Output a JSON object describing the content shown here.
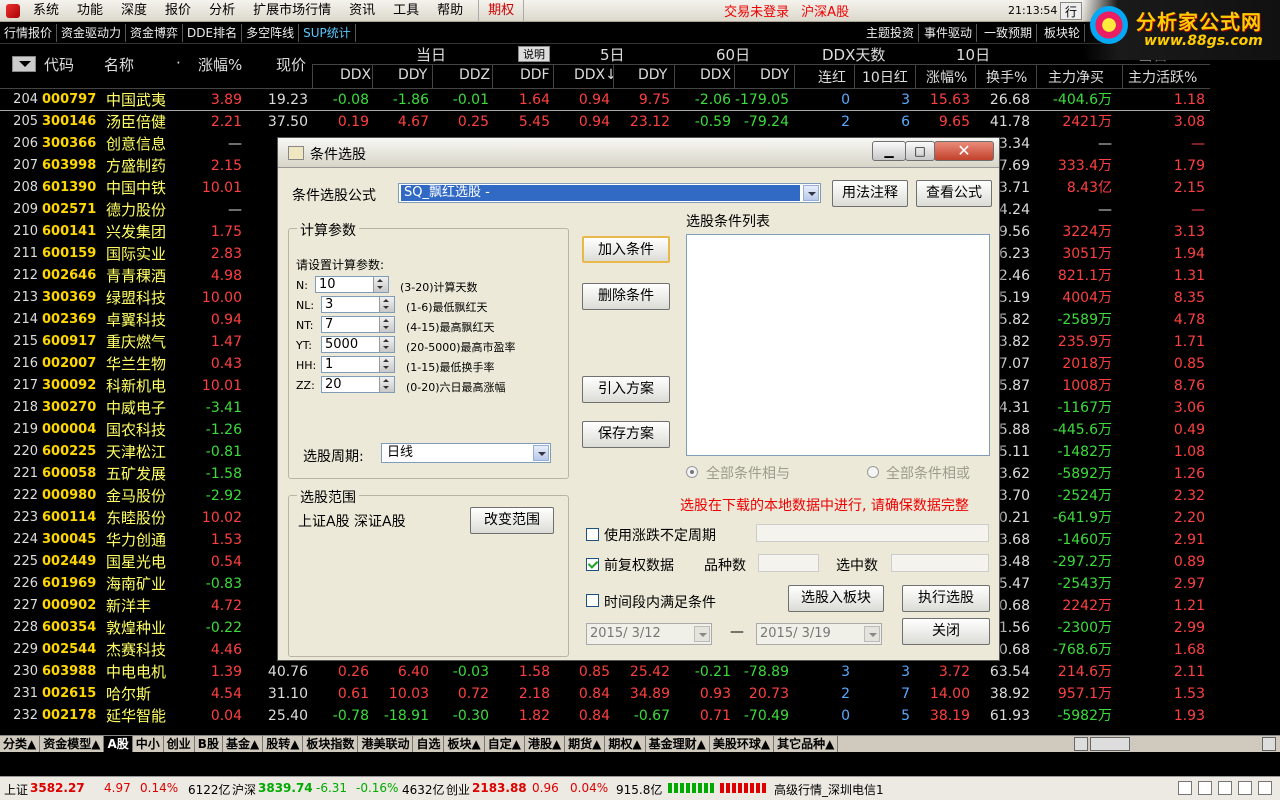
{
  "menu": {
    "items": [
      "系统",
      "功能",
      "深度",
      "报价",
      "分析",
      "扩展市场行情",
      "资讯",
      "工具",
      "帮助"
    ],
    "qiquan": "期权",
    "login": "交易未登录",
    "market": "沪深A股",
    "clock": "21:13:54 周四",
    "trade": "行"
  },
  "brand": {
    "name": "分析家公式网",
    "url": "www.88gs.com"
  },
  "toolbar": {
    "items": [
      "行情报价",
      "资金驱动力",
      "资金博弈",
      "DDE排名",
      "多空阵线",
      "SUP统计"
    ],
    "right_items": [
      "主题投资",
      "事件驱动",
      "一致预期",
      "板块轮"
    ]
  },
  "header": {
    "code": "代码",
    "name": "名称",
    "change": "涨幅%",
    "price": "现价",
    "group_today": "当日",
    "explain": "说明",
    "group_5": "5日",
    "group_60": "60日",
    "group_ddx_days": "DDX天数",
    "group_10": "10日",
    "group_today2": "当日",
    "sub": [
      "DDX",
      "DDY",
      "DDZ",
      "DDF",
      "DDX↓",
      "DDY",
      "DDX",
      "DDY",
      "连红",
      "10日红",
      "涨幅%",
      "换手%",
      "主力净买",
      "主力活跃%"
    ]
  },
  "rows": [
    {
      "i": "204",
      "code": "000797",
      "name": "中国武夷",
      "chg": "3.89",
      "price": "19.23",
      "ddx": "-0.08",
      "ddy": "-1.86",
      "ddz": "-0.01",
      "ddf": "1.64",
      "ddx5": "0.94",
      "ddy5": "9.75",
      "ddx60": "-2.06",
      "ddy60": "-179.05",
      "lh": "0",
      "h10": "3",
      "zf10": "15.63",
      "hs": "26.68",
      "net": "-404.6万",
      "act": "1.18"
    },
    {
      "i": "205",
      "code": "300146",
      "name": "汤臣倍健",
      "chg": "2.21",
      "price": "37.50",
      "ddx": "0.19",
      "ddy": "4.67",
      "ddz": "0.25",
      "ddf": "5.45",
      "ddx5": "0.94",
      "ddy5": "23.12",
      "ddx60": "-0.59",
      "ddy60": "-79.24",
      "lh": "2",
      "h10": "6",
      "zf10": "9.65",
      "hs": "41.78",
      "net": "2421万",
      "act": "3.08"
    },
    {
      "i": "206",
      "code": "300366",
      "name": "创意信息",
      "chg": "—",
      "price": "",
      "ddx": "",
      "ddy": "",
      "ddz": "",
      "ddf": "",
      "ddx5": "",
      "ddy5": "",
      "ddx60": "",
      "ddy60": "",
      "lh": "",
      "h10": "",
      "zf10": "",
      "hs": "3.34",
      "net": "—",
      "act": "—"
    },
    {
      "i": "207",
      "code": "603998",
      "name": "方盛制药",
      "chg": "2.15",
      "price": "",
      "ddx": "",
      "ddy": "",
      "ddz": "",
      "ddf": "",
      "ddx5": "",
      "ddy5": "",
      "ddx60": "",
      "ddy60": "",
      "lh": "",
      "h10": "",
      "zf10": "",
      "hs": "7.69",
      "net": "333.4万",
      "act": "1.79"
    },
    {
      "i": "208",
      "code": "601390",
      "name": "中国中铁",
      "chg": "10.01",
      "price": "",
      "ddx": "",
      "ddy": "",
      "ddz": "",
      "ddf": "",
      "ddx5": "",
      "ddy5": "",
      "ddx60": "",
      "ddy60": "",
      "lh": "",
      "h10": "",
      "zf10": "",
      "hs": "3.71",
      "net": "8.43亿",
      "act": "2.15"
    },
    {
      "i": "209",
      "code": "002571",
      "name": "德力股份",
      "chg": "—",
      "price": "",
      "ddx": "",
      "ddy": "",
      "ddz": "",
      "ddf": "",
      "ddx5": "",
      "ddy5": "",
      "ddx60": "",
      "ddy60": "",
      "lh": "",
      "h10": "",
      "zf10": "",
      "hs": "4.24",
      "net": "—",
      "act": "—"
    },
    {
      "i": "210",
      "code": "600141",
      "name": "兴发集团",
      "chg": "1.75",
      "price": "",
      "ddx": "",
      "ddy": "",
      "ddz": "",
      "ddf": "",
      "ddx5": "",
      "ddy5": "",
      "ddx60": "",
      "ddy60": "",
      "lh": "",
      "h10": "",
      "zf10": "",
      "hs": "9.56",
      "net": "3224万",
      "act": "3.13"
    },
    {
      "i": "211",
      "code": "600159",
      "name": "国际实业",
      "chg": "2.83",
      "price": "",
      "ddx": "",
      "ddy": "",
      "ddz": "",
      "ddf": "",
      "ddx5": "",
      "ddy5": "",
      "ddx60": "",
      "ddy60": "",
      "lh": "",
      "h10": "",
      "zf10": "",
      "hs": "6.23",
      "net": "3051万",
      "act": "1.94"
    },
    {
      "i": "212",
      "code": "002646",
      "name": "青青稞酒",
      "chg": "4.98",
      "price": "",
      "ddx": "",
      "ddy": "",
      "ddz": "",
      "ddf": "",
      "ddx5": "",
      "ddy5": "",
      "ddx60": "",
      "ddy60": "",
      "lh": "",
      "h10": "",
      "zf10": "",
      "hs": "2.46",
      "net": "821.1万",
      "act": "1.31"
    },
    {
      "i": "213",
      "code": "300369",
      "name": "绿盟科技",
      "chg": "10.00",
      "price": "",
      "ddx": "",
      "ddy": "",
      "ddz": "",
      "ddf": "",
      "ddx5": "",
      "ddy5": "",
      "ddx60": "",
      "ddy60": "",
      "lh": "",
      "h10": "",
      "zf10": "",
      "hs": "5.19",
      "net": "4004万",
      "act": "8.35"
    },
    {
      "i": "214",
      "code": "002369",
      "name": "卓翼科技",
      "chg": "0.94",
      "price": "",
      "ddx": "",
      "ddy": "",
      "ddz": "",
      "ddf": "",
      "ddx5": "",
      "ddy5": "",
      "ddx60": "",
      "ddy60": "",
      "lh": "",
      "h10": "",
      "zf10": "",
      "hs": "5.82",
      "net": "-2589万",
      "act": "4.78"
    },
    {
      "i": "215",
      "code": "600917",
      "name": "重庆燃气",
      "chg": "1.47",
      "price": "",
      "ddx": "",
      "ddy": "",
      "ddz": "",
      "ddf": "",
      "ddx5": "",
      "ddy5": "",
      "ddx60": "",
      "ddy60": "",
      "lh": "",
      "h10": "",
      "zf10": "",
      "hs": "3.82",
      "net": "235.9万",
      "act": "1.71"
    },
    {
      "i": "216",
      "code": "002007",
      "name": "华兰生物",
      "chg": "0.43",
      "price": "",
      "ddx": "",
      "ddy": "",
      "ddz": "",
      "ddf": "",
      "ddx5": "",
      "ddy5": "",
      "ddx60": "",
      "ddy60": "",
      "lh": "",
      "h10": "",
      "zf10": "",
      "hs": "7.07",
      "net": "2018万",
      "act": "0.85"
    },
    {
      "i": "217",
      "code": "300092",
      "name": "科新机电",
      "chg": "10.01",
      "price": "",
      "ddx": "",
      "ddy": "",
      "ddz": "",
      "ddf": "",
      "ddx5": "",
      "ddy5": "",
      "ddx60": "",
      "ddy60": "",
      "lh": "",
      "h10": "",
      "zf10": "",
      "hs": "5.87",
      "net": "1008万",
      "act": "8.76"
    },
    {
      "i": "218",
      "code": "300270",
      "name": "中威电子",
      "chg": "-3.41",
      "price": "",
      "ddx": "",
      "ddy": "",
      "ddz": "",
      "ddf": "",
      "ddx5": "",
      "ddy5": "",
      "ddx60": "",
      "ddy60": "",
      "lh": "",
      "h10": "",
      "zf10": "",
      "hs": "4.31",
      "net": "-1167万",
      "act": "3.06"
    },
    {
      "i": "219",
      "code": "000004",
      "name": "国农科技",
      "chg": "-1.26",
      "price": "",
      "ddx": "",
      "ddy": "",
      "ddz": "",
      "ddf": "",
      "ddx5": "",
      "ddy5": "",
      "ddx60": "",
      "ddy60": "",
      "lh": "",
      "h10": "",
      "zf10": "",
      "hs": "5.88",
      "net": "-445.6万",
      "act": "0.49"
    },
    {
      "i": "220",
      "code": "600225",
      "name": "天津松江",
      "chg": "-0.81",
      "price": "",
      "ddx": "",
      "ddy": "",
      "ddz": "",
      "ddf": "",
      "ddx5": "",
      "ddy5": "",
      "ddx60": "",
      "ddy60": "",
      "lh": "",
      "h10": "",
      "zf10": "",
      "hs": "5.11",
      "net": "-1482万",
      "act": "1.08"
    },
    {
      "i": "221",
      "code": "600058",
      "name": "五矿发展",
      "chg": "-1.58",
      "price": "",
      "ddx": "",
      "ddy": "",
      "ddz": "",
      "ddf": "",
      "ddx5": "",
      "ddy5": "",
      "ddx60": "",
      "ddy60": "",
      "lh": "",
      "h10": "",
      "zf10": "",
      "hs": "3.62",
      "net": "-5892万",
      "act": "1.26"
    },
    {
      "i": "222",
      "code": "000980",
      "name": "金马股份",
      "chg": "-2.92",
      "price": "",
      "ddx": "",
      "ddy": "",
      "ddz": "",
      "ddf": "",
      "ddx5": "",
      "ddy5": "",
      "ddx60": "",
      "ddy60": "",
      "lh": "",
      "h10": "",
      "zf10": "",
      "hs": "3.70",
      "net": "-2524万",
      "act": "2.32"
    },
    {
      "i": "223",
      "code": "600114",
      "name": "东睦股份",
      "chg": "10.02",
      "price": "",
      "ddx": "",
      "ddy": "",
      "ddz": "",
      "ddf": "",
      "ddx5": "",
      "ddy5": "",
      "ddx60": "",
      "ddy60": "",
      "lh": "",
      "h10": "",
      "zf10": "",
      "hs": "0.21",
      "net": "-641.9万",
      "act": "2.20"
    },
    {
      "i": "224",
      "code": "300045",
      "name": "华力创通",
      "chg": "1.53",
      "price": "",
      "ddx": "",
      "ddy": "",
      "ddz": "",
      "ddf": "",
      "ddx5": "",
      "ddy5": "",
      "ddx60": "",
      "ddy60": "",
      "lh": "",
      "h10": "",
      "zf10": "",
      "hs": "3.68",
      "net": "-1460万",
      "act": "2.91"
    },
    {
      "i": "225",
      "code": "002449",
      "name": "国星光电",
      "chg": "0.54",
      "price": "",
      "ddx": "",
      "ddy": "",
      "ddz": "",
      "ddf": "",
      "ddx5": "",
      "ddy5": "",
      "ddx60": "",
      "ddy60": "",
      "lh": "",
      "h10": "",
      "zf10": "",
      "hs": "3.48",
      "net": "-297.2万",
      "act": "0.89"
    },
    {
      "i": "226",
      "code": "601969",
      "name": "海南矿业",
      "chg": "-0.83",
      "price": "",
      "ddx": "",
      "ddy": "",
      "ddz": "",
      "ddf": "",
      "ddx5": "",
      "ddy5": "",
      "ddx60": "",
      "ddy60": "",
      "lh": "",
      "h10": "",
      "zf10": "",
      "hs": "5.47",
      "net": "-2543万",
      "act": "2.97"
    },
    {
      "i": "227",
      "code": "000902",
      "name": "新洋丰",
      "chg": "4.72",
      "price": "",
      "ddx": "",
      "ddy": "",
      "ddz": "",
      "ddf": "",
      "ddx5": "",
      "ddy5": "",
      "ddx60": "",
      "ddy60": "",
      "lh": "",
      "h10": "",
      "zf10": "",
      "hs": "0.68",
      "net": "2242万",
      "act": "1.21"
    },
    {
      "i": "228",
      "code": "600354",
      "name": "敦煌种业",
      "chg": "-0.22",
      "price": "",
      "ddx": "",
      "ddy": "",
      "ddz": "",
      "ddf": "",
      "ddx5": "",
      "ddy5": "",
      "ddx60": "",
      "ddy60": "",
      "lh": "",
      "h10": "",
      "zf10": "",
      "hs": "1.56",
      "net": "-2300万",
      "act": "2.99"
    },
    {
      "i": "229",
      "code": "002544",
      "name": "杰赛科技",
      "chg": "4.46",
      "price": "",
      "ddx": "",
      "ddy": "",
      "ddz": "",
      "ddf": "",
      "ddx5": "",
      "ddy5": "",
      "ddx60": "",
      "ddy60": "",
      "lh": "",
      "h10": "",
      "zf10": "",
      "hs": "0.68",
      "net": "-768.6万",
      "act": "1.68"
    },
    {
      "i": "230",
      "code": "603988",
      "name": "中电电机",
      "chg": "1.39",
      "price": "40.76",
      "ddx": "0.26",
      "ddy": "6.40",
      "ddz": "-0.03",
      "ddf": "1.58",
      "ddx5": "0.85",
      "ddy5": "25.42",
      "ddx60": "-0.21",
      "ddy60": "-78.89",
      "lh": "3",
      "h10": "3",
      "zf10": "3.72",
      "hs": "63.54",
      "net": "214.6万",
      "act": "2.11"
    },
    {
      "i": "231",
      "code": "002615",
      "name": "哈尔斯",
      "chg": "4.54",
      "price": "31.10",
      "ddx": "0.61",
      "ddy": "10.03",
      "ddz": "0.72",
      "ddf": "2.18",
      "ddx5": "0.84",
      "ddy5": "34.89",
      "ddx60": "0.93",
      "ddy60": "20.73",
      "lh": "2",
      "h10": "7",
      "zf10": "14.00",
      "hs": "38.92",
      "net": "957.1万",
      "act": "1.53"
    },
    {
      "i": "232",
      "code": "002178",
      "name": "延华智能",
      "chg": "0.04",
      "price": "25.40",
      "ddx": "-0.78",
      "ddy": "-18.91",
      "ddz": "-0.30",
      "ddf": "1.82",
      "ddx5": "0.84",
      "ddy5": "-0.67",
      "ddx60": "0.71",
      "ddy60": "-70.49",
      "lh": "0",
      "h10": "5",
      "zf10": "38.19",
      "hs": "61.93",
      "net": "-5982万",
      "act": "1.93"
    }
  ],
  "tabs": [
    "分类▲",
    "资金模型▲",
    "A股",
    "中小",
    "创业",
    "B股",
    "基金▲",
    "股转▲",
    "板块指数",
    "港美联动",
    "自选",
    "板块▲",
    "自定▲",
    "港股▲",
    "期货▲",
    "期权▲",
    "基金理财▲",
    "美股环球▲",
    "其它品种▲"
  ],
  "status": {
    "sh_label": "上证",
    "sh_val": "3582.27",
    "sh_chg": "4.97",
    "sh_pct": "0.14%",
    "sh_amt": "6122亿",
    "hs_label": "沪深",
    "hs_val": "3839.74",
    "hs_chg": "-6.31",
    "hs_pct": "-0.16%",
    "hs_amt": "4632亿",
    "cy_label": "创业",
    "cy_val": "2183.88",
    "cy_chg": "0.96",
    "cy_pct": "0.04%",
    "cy_amt": "915.8亿",
    "server": "高级行情_深圳电信1"
  },
  "dialog": {
    "title": "条件选股",
    "formula_label": "条件选股公式",
    "formula_value": "SQ_飘红选股  -",
    "usage_btn": "用法注释",
    "view_btn": "查看公式",
    "params_group": "计算参数",
    "params_hint": "请设置计算参数:",
    "params": [
      {
        "name": "N:",
        "value": "10",
        "desc": "(3-20)计算天数"
      },
      {
        "name": "NL:",
        "value": "3",
        "desc": "(1-6)最低飘红天"
      },
      {
        "name": "NT:",
        "value": "7",
        "desc": "(4-15)最高飘红天"
      },
      {
        "name": "YT:",
        "value": "5000",
        "desc": "(20-5000)最高市盈率"
      },
      {
        "name": "HH:",
        "value": "1",
        "desc": "(1-15)最低换手率"
      },
      {
        "name": "ZZ:",
        "value": "20",
        "desc": "(0-20)六日最高涨幅"
      }
    ],
    "period_label": "选股周期:",
    "period_value": "日线",
    "add_btn": "加入条件",
    "del_btn": "删除条件",
    "import_btn": "引入方案",
    "save_btn": "保存方案",
    "cond_list_label": "选股条件列表",
    "radio_and": "全部条件相与",
    "radio_or": "全部条件相或",
    "warning": "选股在下载的本地数据中进行, 请确保数据完整",
    "range_group": "选股范围",
    "range_value": "上证A股  深证A股",
    "change_range_btn": "改变范围",
    "chk_uncertain": "使用涨跌不定周期",
    "chk_adjust": "前复权数据",
    "count_label": "品种数",
    "selected_label": "选中数",
    "chk_timerange": "时间段内满足条件",
    "to_block_btn": "选股入板块",
    "exec_btn": "执行选股",
    "close_btn": "关闭",
    "date_from": "2015/ 3/12",
    "date_sep": "—",
    "date_to": "2015/ 3/19"
  }
}
